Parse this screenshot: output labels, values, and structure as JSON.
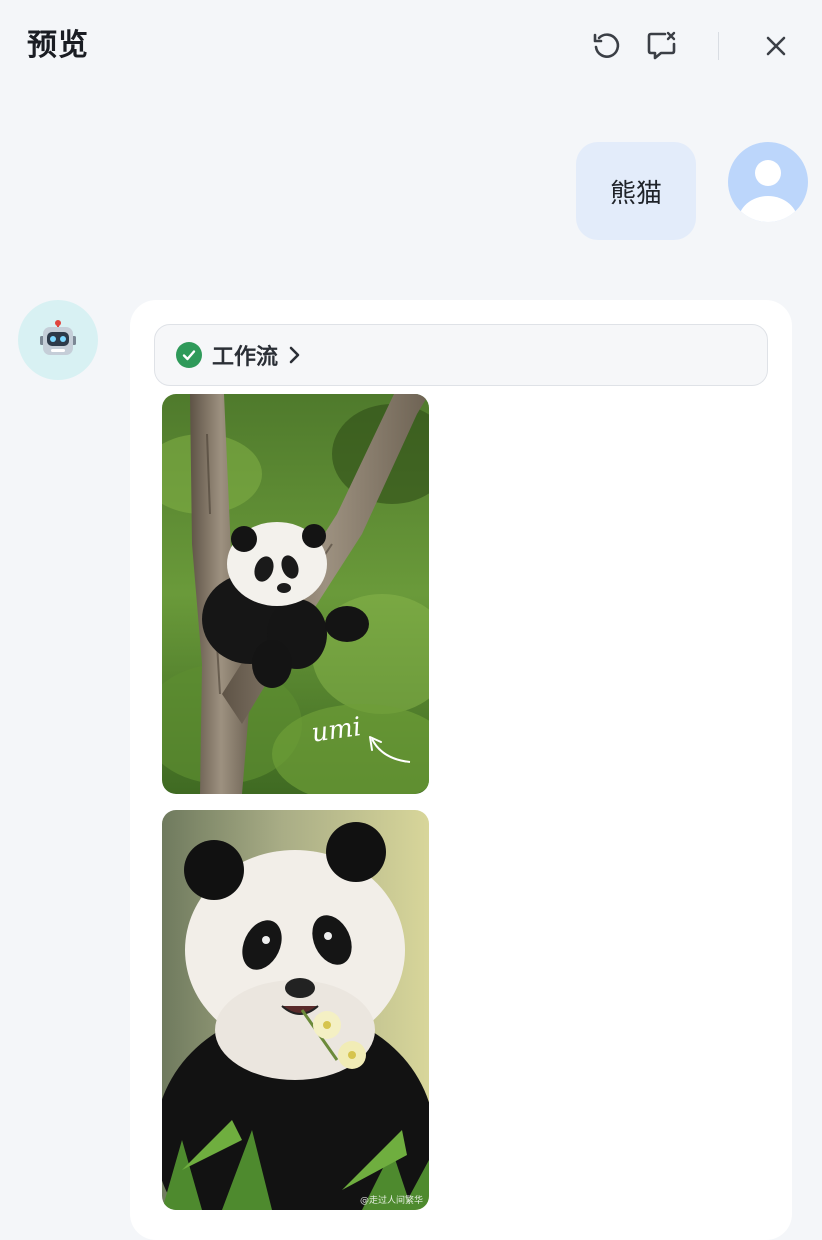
{
  "header": {
    "title": "预览",
    "actions": [
      {
        "name": "refresh",
        "icon": "refresh-icon"
      },
      {
        "name": "clear-chat",
        "icon": "clear-chat-icon"
      },
      {
        "name": "close",
        "icon": "close-icon"
      }
    ]
  },
  "conversation": {
    "user_message": {
      "text": "熊猫",
      "avatar_icon": "user-avatar-icon"
    },
    "bot_message": {
      "avatar_icon": "robot-icon",
      "workflow": {
        "status_icon": "check-circle-icon",
        "label": "工作流",
        "expand_icon": "chevron-right-icon"
      },
      "images": [
        {
          "subject": "panda-on-tree",
          "caption_overlay": "umi"
        },
        {
          "subject": "panda-eating-flower",
          "watermark": "@走过人间繁华"
        }
      ]
    }
  },
  "colors": {
    "background": "#f4f6f9",
    "user_bubble": "#e3ecfa",
    "user_avatar": "#bcd6fb",
    "bot_avatar": "#d8f1f3",
    "success": "#2f9a5a"
  }
}
